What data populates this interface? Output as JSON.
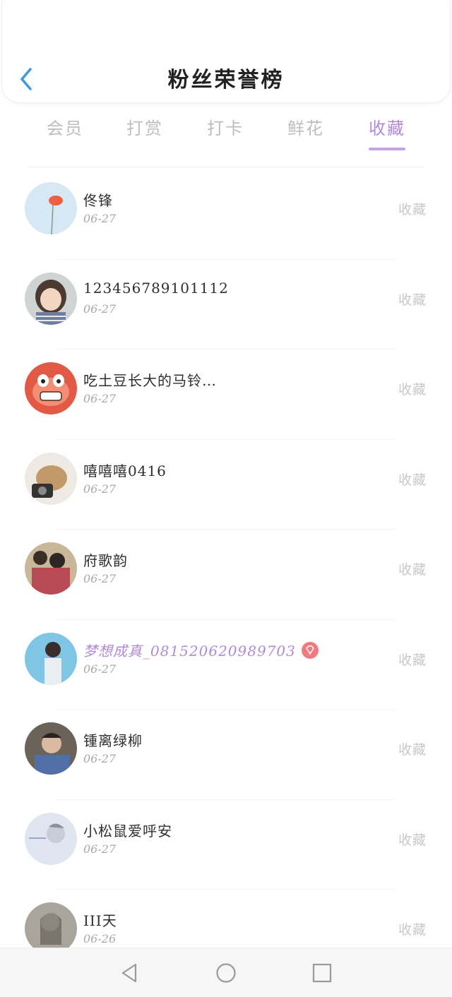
{
  "header": {
    "title": "粉丝荣誉榜",
    "back_icon": "chevron-left-icon"
  },
  "tabs": [
    {
      "label": "会员",
      "active": false
    },
    {
      "label": "打赏",
      "active": false
    },
    {
      "label": "打卡",
      "active": false
    },
    {
      "label": "鲜花",
      "active": false
    },
    {
      "label": "收藏",
      "active": true
    }
  ],
  "colors": {
    "accent": "#b08ad6",
    "back": "#3a9be0",
    "muted": "#c8c8c8",
    "vip_badge": "#f07a80"
  },
  "list": [
    {
      "name": "佟锋",
      "date": "06-27",
      "action": "收藏",
      "vip": false
    },
    {
      "name": "123456789101112",
      "date": "06-27",
      "action": "收藏",
      "vip": false
    },
    {
      "name": "吃土豆长大的马铃…",
      "date": "06-27",
      "action": "收藏",
      "vip": false
    },
    {
      "name": "嘻嘻嘻0416",
      "date": "06-27",
      "action": "收藏",
      "vip": false
    },
    {
      "name": "府歌韵",
      "date": "06-27",
      "action": "收藏",
      "vip": false
    },
    {
      "name": "梦想成真_081520620989703",
      "date": "06-27",
      "action": "收藏",
      "vip": true
    },
    {
      "name": "锺离绿柳",
      "date": "06-27",
      "action": "收藏",
      "vip": false
    },
    {
      "name": "小松鼠爱呼安",
      "date": "06-27",
      "action": "收藏",
      "vip": false
    },
    {
      "name": "III天",
      "date": "06-26",
      "action": "收藏",
      "vip": false
    }
  ],
  "navbar": {
    "back_icon": "triangle-back-icon",
    "home_icon": "circle-home-icon",
    "recents_icon": "square-recents-icon"
  }
}
